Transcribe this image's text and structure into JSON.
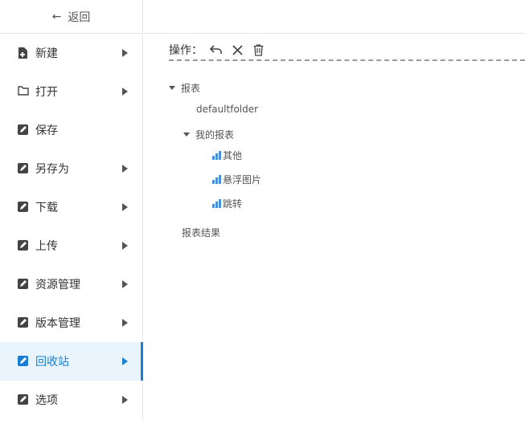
{
  "sidebar": {
    "back_label": "返回",
    "items": [
      {
        "label": "新建",
        "icon": "file-plus-icon",
        "has_submenu": true
      },
      {
        "label": "打开",
        "icon": "folder-icon",
        "has_submenu": true
      },
      {
        "label": "保存",
        "icon": "edit-icon",
        "has_submenu": false
      },
      {
        "label": "另存为",
        "icon": "edit-icon",
        "has_submenu": true
      },
      {
        "label": "下载",
        "icon": "edit-icon",
        "has_submenu": true
      },
      {
        "label": "上传",
        "icon": "edit-icon",
        "has_submenu": true
      },
      {
        "label": "资源管理",
        "icon": "edit-icon",
        "has_submenu": true
      },
      {
        "label": "版本管理",
        "icon": "edit-icon",
        "has_submenu": true
      },
      {
        "label": "回收站",
        "icon": "edit-icon",
        "has_submenu": true,
        "active": true
      },
      {
        "label": "选项",
        "icon": "edit-icon",
        "has_submenu": true
      }
    ]
  },
  "toolbar": {
    "label": "操作：",
    "buttons": [
      "undo-icon",
      "close-icon",
      "trash-icon"
    ]
  },
  "tree": {
    "root": "报表",
    "default_folder": "defaultfolder",
    "my_reports": "我的报表",
    "reports": [
      "其他",
      "悬浮图片",
      "跳转"
    ],
    "results": "报表结果"
  },
  "colors": {
    "accent": "#1a7fd4",
    "active_bg": "#e9f4fd",
    "chart_icon": "#4a90d9"
  }
}
